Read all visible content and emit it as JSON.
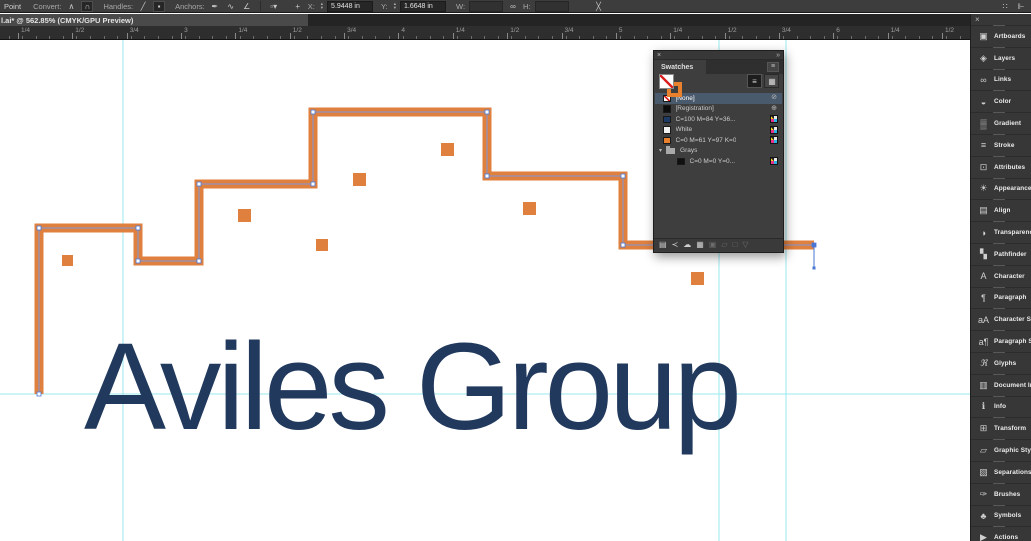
{
  "control_bar": {
    "tool_label": "Point",
    "convert_label": "Convert:",
    "handles_label": "Handles:",
    "anchors_label": "Anchors:",
    "x_label": "X:",
    "x_value": "5.9448 in",
    "y_label": "Y:",
    "y_value": "1.6648 in",
    "w_label": "W:",
    "w_value": "",
    "h_label": "H:",
    "h_value": "",
    "icons": {
      "convert_corner": "∧",
      "convert_smooth": "∩",
      "handles_show": "╱",
      "handles_hide": "▪",
      "anchors_remove": "✒",
      "anchors_smooth": "∿",
      "anchors_corner": "∠",
      "selection_style": "▫▾",
      "reference_point": "+",
      "link": "∞",
      "constrain": "╳",
      "snap_grid": "∷",
      "collapse_panels": "⊩"
    }
  },
  "tab_bar": {
    "document_title": "l.ai* @ 562.85% (CMYK/GPU Preview)"
  },
  "ruler": {
    "labels": [
      "1/4",
      "1/2",
      "3/4",
      "3",
      "1/4",
      "1/2",
      "3/4",
      "4",
      "1/4",
      "1/2",
      "3/4",
      "5",
      "1/4",
      "1/2",
      "3/4",
      "6",
      "1/4",
      "1/2"
    ]
  },
  "canvas": {
    "logo_text": "Aviles Group",
    "logo_color": "#21395d",
    "path_color": "#e0803e",
    "guide_color": "#9ae9ef",
    "selection_color": "#7d99dd",
    "anchor_color": "#4a77d4",
    "stroke_width": 9,
    "path_points": [
      [
        39,
        394
      ],
      [
        39,
        228
      ],
      [
        138,
        228
      ],
      [
        138,
        261
      ],
      [
        199,
        261
      ],
      [
        199,
        184
      ],
      [
        313,
        184
      ],
      [
        313,
        112
      ],
      [
        487,
        112
      ],
      [
        487,
        176
      ],
      [
        623,
        176
      ],
      [
        623,
        245
      ],
      [
        814,
        245
      ]
    ],
    "handle": [
      [
        814,
        245
      ],
      [
        814,
        268
      ]
    ],
    "squares": [
      [
        62,
        255,
        11
      ],
      [
        238,
        209,
        13
      ],
      [
        316,
        239,
        12
      ],
      [
        353,
        173,
        13
      ],
      [
        441,
        143,
        13
      ],
      [
        523,
        202,
        13
      ],
      [
        691,
        272,
        13
      ]
    ],
    "guides_vertical": [
      123,
      719,
      786
    ],
    "guides_horizontal": [
      394
    ]
  },
  "swatches_panel": {
    "close_glyph": "×",
    "collapse_glyph": "»",
    "title": "Swatches",
    "menu_glyph": "≡",
    "view_list_glyph": "≡",
    "view_grid_glyph": "▦",
    "rows": [
      {
        "label": "[None]",
        "type": "none",
        "right": "⊘",
        "right_kind": "none",
        "selected": true
      },
      {
        "label": "[Registration]",
        "type": "color",
        "chip": "#0d0d0d",
        "right": "⊕",
        "right_kind": "registration"
      },
      {
        "label": "C=100 M=84 Y=36...",
        "type": "color",
        "chip": "#1c3a63",
        "right": "",
        "right_kind": "cmyk"
      },
      {
        "label": "White",
        "type": "color",
        "chip": "#f2f2f2",
        "right": "",
        "right_kind": "cmyk"
      },
      {
        "label": "C=0 M=61 Y=97 K=0",
        "type": "color",
        "chip": "#e8802d",
        "right": "",
        "right_kind": "cmyk"
      },
      {
        "label": "Grays",
        "type": "group",
        "chev": "▾"
      },
      {
        "label": "C=0 M=0 Y=0...",
        "type": "color",
        "chip": "#101010",
        "right": "",
        "right_kind": "cmyk",
        "indent": true
      }
    ],
    "footer_icons": [
      {
        "name": "swatch-libraries-menu-icon",
        "glyph": "▤",
        "enabled": true
      },
      {
        "name": "swatch-kinds-menu-icon",
        "glyph": "≺",
        "enabled": true
      },
      {
        "name": "cc-libraries-icon",
        "glyph": "☁",
        "enabled": true
      },
      {
        "name": "color-themes-icon",
        "glyph": "▦",
        "enabled": true
      },
      {
        "name": "swatch-options-icon",
        "glyph": "▣",
        "enabled": false
      },
      {
        "name": "new-color-group-icon",
        "glyph": "▱",
        "enabled": false
      },
      {
        "name": "new-swatch-icon",
        "glyph": "□",
        "enabled": false
      },
      {
        "name": "delete-swatch-icon",
        "glyph": "▽",
        "enabled": false
      }
    ]
  },
  "dock": {
    "close_glyph": "×",
    "items": [
      {
        "label": "Artboards",
        "icon": "▣",
        "name": "artboards"
      },
      {
        "label": "Layers",
        "icon": "◈",
        "name": "layers"
      },
      {
        "label": "Links",
        "icon": "∞",
        "name": "links"
      },
      {
        "label": "Color",
        "icon": "◒",
        "name": "color"
      },
      {
        "label": "Gradient",
        "icon": "▒",
        "name": "gradient"
      },
      {
        "label": "Stroke",
        "icon": "≡",
        "name": "stroke"
      },
      {
        "label": "Attributes",
        "icon": "⊡",
        "name": "attributes"
      },
      {
        "label": "Appearance",
        "icon": "☀",
        "name": "appearance"
      },
      {
        "label": "Align",
        "icon": "▤",
        "name": "align"
      },
      {
        "label": "Transparency",
        "icon": "◑",
        "name": "transparency"
      },
      {
        "label": "Pathfinder",
        "icon": "▚",
        "name": "pathfinder"
      },
      {
        "label": "Character",
        "icon": "A",
        "name": "character"
      },
      {
        "label": "Paragraph",
        "icon": "¶",
        "name": "paragraph"
      },
      {
        "label": "Character Sty...",
        "icon": "aA",
        "name": "character-styles"
      },
      {
        "label": "Paragraph St...",
        "icon": "a¶",
        "name": "paragraph-styles"
      },
      {
        "label": "Glyphs",
        "icon": "ℜ",
        "name": "glyphs"
      },
      {
        "label": "Document Info",
        "icon": "▥",
        "name": "document-info"
      },
      {
        "label": "Info",
        "icon": "ℹ",
        "name": "info"
      },
      {
        "label": "Transform",
        "icon": "⊞",
        "name": "transform"
      },
      {
        "label": "Graphic Styles",
        "icon": "▱",
        "name": "graphic-styles"
      },
      {
        "label": "Separations P...",
        "icon": "▧",
        "name": "separations-preview"
      },
      {
        "label": "Brushes",
        "icon": "✑",
        "name": "brushes"
      },
      {
        "label": "Symbols",
        "icon": "♣",
        "name": "symbols"
      },
      {
        "label": "Actions",
        "icon": "▶",
        "name": "actions"
      }
    ]
  }
}
